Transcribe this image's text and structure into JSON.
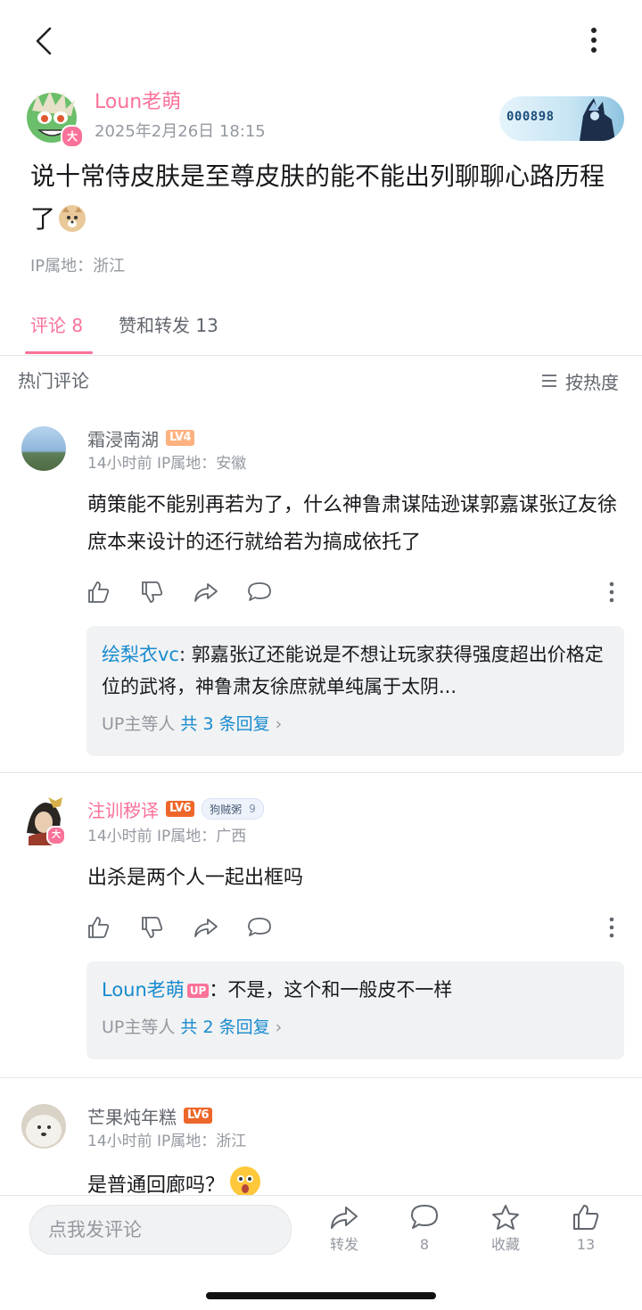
{
  "post": {
    "author": "Loun老萌",
    "time": "2025年2月26日 18:15",
    "badge_card_no": "000898",
    "text": "说十常侍皮肤是至尊皮肤的能不能出列聊聊心路历程了",
    "ip": "IP属地：浙江"
  },
  "tabs": [
    {
      "label": "评论 8",
      "active": true
    },
    {
      "label": "赞和转发 13",
      "active": false
    }
  ],
  "section": {
    "title": "热门评论",
    "sort_label": "按热度"
  },
  "comments": [
    {
      "user": "霜浸南湖",
      "level": "LV4",
      "meta": "14小时前 IP属地：安徽",
      "text": "萌策能不能别再若为了，什么神鲁肃谋陆逊谋郭嘉谋张辽友徐庶本来设计的还行就给若为搞成依托了",
      "reply": {
        "user": "绘梨衣vc",
        "sep": ": ",
        "text": "郭嘉张辽还能说是不想让玩家获得强度超出价格定位的武将，神鲁肃友徐庶就单纯属于太阴...",
        "more_prefix": "UP主等人 ",
        "more_link": "共 3 条回复"
      }
    },
    {
      "user": "注训秽译",
      "level": "LV6",
      "fan_badge": "狗贼粥",
      "fan_level": "9",
      "meta": "14小时前 IP属地：广西",
      "text": "出杀是两个人一起出框吗",
      "reply": {
        "user": "Loun老萌",
        "up_tag": "UP",
        "sep": "：",
        "text": "不是，这个和一般皮不一样",
        "more_prefix": "UP主等人 ",
        "more_link": "共 2 条回复"
      }
    },
    {
      "user": "芒果炖年糕",
      "level": "LV6",
      "meta": "14小时前 IP属地：浙江",
      "text": "是普通回廊吗？"
    }
  ],
  "bottom": {
    "placeholder": "点我发评论",
    "share": "转发",
    "comment_count": "8",
    "favorite": "收藏",
    "like_count": "13"
  },
  "colors": {
    "accent": "#fb7299",
    "link": "#178bcf",
    "level6": "#ee672a",
    "level4": "#ffb27f"
  }
}
